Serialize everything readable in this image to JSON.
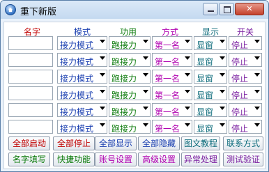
{
  "window": {
    "title": "重下新版"
  },
  "headers": {
    "name": "名字",
    "mode": "模式",
    "function": "功用",
    "method": "方式",
    "display": "显示",
    "switch": "开关"
  },
  "rows": [
    {
      "name": "",
      "mode": "接力模式",
      "function": "跑接力",
      "method": "第一名",
      "display": "显窗",
      "switch": "停止"
    },
    {
      "name": "",
      "mode": "接力模式",
      "function": "跑接力",
      "method": "第一名",
      "display": "显窗",
      "switch": "停止"
    },
    {
      "name": "",
      "mode": "接力模式",
      "function": "跑接力",
      "method": "第一名",
      "display": "显窗",
      "switch": "停止"
    },
    {
      "name": "",
      "mode": "接力模式",
      "function": "跑接力",
      "method": "第一名",
      "display": "显窗",
      "switch": "停止"
    },
    {
      "name": "",
      "mode": "接力模式",
      "function": "跑接力",
      "method": "第一名",
      "display": "显窗",
      "switch": "停止"
    },
    {
      "name": "",
      "mode": "接力模式",
      "function": "跑接力",
      "method": "第一名",
      "display": "显窗",
      "switch": "停止"
    }
  ],
  "buttons_row1": {
    "start_all": "全部启动",
    "stop_all": "全部停止",
    "show_all": "全部显示",
    "hide_all": "全部隐藏",
    "tutorial": "图文教程",
    "contact": "联系方式"
  },
  "buttons_row2": {
    "fill_names": "名字填写",
    "quick_function": "快捷功能",
    "account_settings": "账号设置",
    "advanced_settings": "高级设置",
    "exception_handling": "异常处理",
    "test_verify": "测试验证"
  },
  "colors": {
    "red": "#c00000",
    "blue": "#1a3fb0",
    "green": "#0a7a0a",
    "magenta": "#b000b0",
    "teal": "#0a6a7a",
    "purple": "#7a1fa0"
  }
}
